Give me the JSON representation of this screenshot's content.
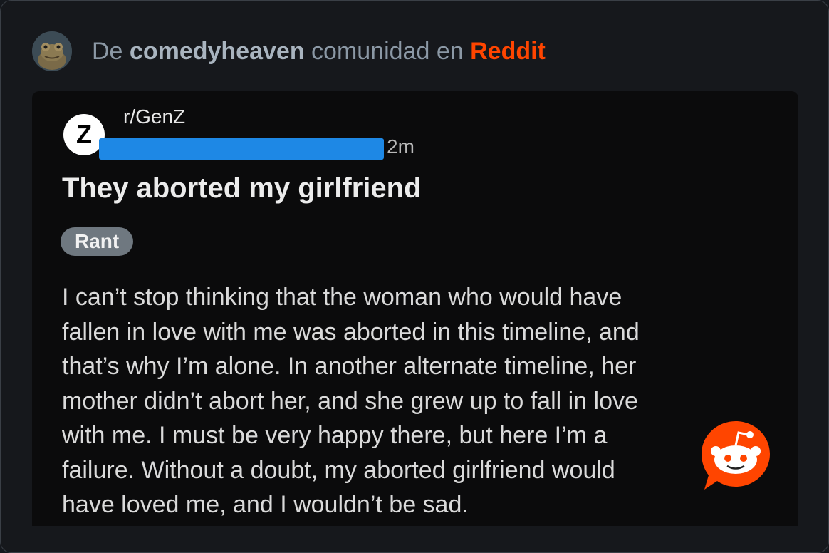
{
  "header": {
    "prefix": "De",
    "community": "comedyheaven",
    "middle": "comunidad en",
    "platform": "Reddit"
  },
  "post": {
    "subreddit_icon_letter": "Z",
    "subreddit": "r/GenZ",
    "time": "2m",
    "title": "They aborted my girlfriend",
    "flair": "Rant",
    "body_lines": [
      "I can’t stop thinking that the woman who would have",
      "fallen in love with me was aborted in this timeline, and",
      "that’s why I’m alone. In another alternate timeline, her",
      "mother didn’t abort her, and she grew up to fall in love",
      "with me. I must be very happy there, but here I’m a",
      "failure. Without a doubt, my aborted girlfriend would",
      "have loved me, and I wouldn’t be sad."
    ]
  },
  "colors": {
    "accent": "#ff4500",
    "redaction": "#1e88e5",
    "flair_bg": "#6f7880"
  },
  "icons": {
    "avatar": "frog-avatar",
    "overlay": "reddit-snoo-icon"
  }
}
